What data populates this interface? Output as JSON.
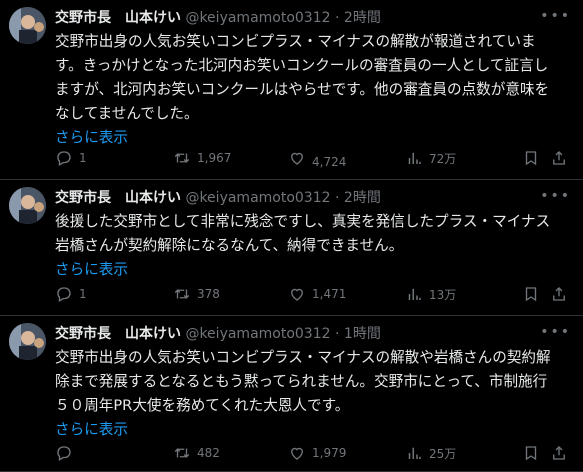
{
  "tweets": [
    {
      "name": "交野市長　山本けい",
      "handle": "@keiyamamoto0312",
      "dot": "·",
      "time": "2時間",
      "lines": [
        "交野市出身の人気お笑いコンビプラス・マイナスの解散が報道されていま",
        "す。きっかけとなった北河内お笑いコンクールの審査員の一人として証言し",
        "ますが、北河内お笑いコンクールはやらせです。他の審査員の点数が意味を",
        "なしてませんでした。"
      ],
      "show_more": "さらに表示",
      "replies": "1",
      "reposts": "1,967",
      "likes": "4,724",
      "views": "72万"
    },
    {
      "name": "交野市長　山本けい",
      "handle": "@keiyamamoto0312",
      "dot": "·",
      "time": "2時間",
      "lines": [
        "後援した交野市として非常に残念ですし、真実を発信したプラス・マイナス",
        "岩橋さんが契約解除になるなんて、納得できません。"
      ],
      "show_more": "さらに表示",
      "replies": "1",
      "reposts": "378",
      "likes": "1,471",
      "views": "13万"
    },
    {
      "name": "交野市長　山本けい",
      "handle": "@keiyamamoto0312",
      "dot": "·",
      "time": "1時間",
      "lines": [
        "交野市出身の人気お笑いコンビプラス・マイナスの解散や岩橋さんの契約解",
        "除まで発展するとなるともう黙ってられません。交野市にとって、市制施行",
        "５０周年PR大使を務めてくれた大恩人です。"
      ],
      "show_more": "さらに表示",
      "replies": "",
      "reposts": "482",
      "likes": "1,979",
      "views": "25万"
    }
  ],
  "icons": {
    "more": "more-icon",
    "reply": "reply-icon",
    "repost": "repost-icon",
    "like": "like-icon",
    "views": "views-icon",
    "bookmark": "bookmark-icon",
    "share": "share-icon"
  },
  "colors": {
    "background": "#000000",
    "text": "#e7e9ea",
    "muted": "#71767b",
    "link": "#1d9bf0",
    "divider": "#2f3336"
  }
}
